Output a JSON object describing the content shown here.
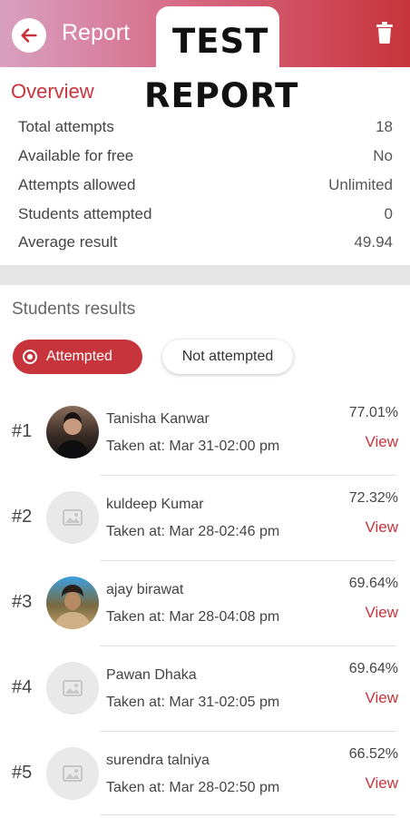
{
  "header": {
    "title": "Report",
    "overlay_line1": "TEST",
    "overlay_line2": "REPORT",
    "accent_color": "#c8343c"
  },
  "overview": {
    "title": "Overview",
    "stats": [
      {
        "label": "Total attempts",
        "value": "18"
      },
      {
        "label": "Available for free",
        "value": "No"
      },
      {
        "label": "Attempts allowed",
        "value": "Unlimited"
      },
      {
        "label": "Students attempted",
        "value": "0"
      },
      {
        "label": "Average result",
        "value": "49.94"
      }
    ]
  },
  "results": {
    "title": "Students results",
    "filters": {
      "attempted": "Attempted",
      "not_attempted": "Not attempted"
    },
    "view_label": "View",
    "students": [
      {
        "rank": "#1",
        "name": "Tanisha Kanwar",
        "taken": "Taken at: Mar 31-02:00 pm",
        "score": "77.01%",
        "avatar": "photo"
      },
      {
        "rank": "#2",
        "name": "kuldeep Kumar",
        "taken": "Taken at: Mar 28-02:46 pm",
        "score": "72.32%",
        "avatar": "placeholder"
      },
      {
        "rank": "#3",
        "name": "ajay birawat",
        "taken": "Taken at: Mar 28-04:08 pm",
        "score": "69.64%",
        "avatar": "photo"
      },
      {
        "rank": "#4",
        "name": "Pawan Dhaka",
        "taken": "Taken at: Mar 31-02:05 pm",
        "score": "69.64%",
        "avatar": "placeholder"
      },
      {
        "rank": "#5",
        "name": "surendra talniya",
        "taken": "Taken at: Mar 28-02:50 pm",
        "score": "66.52%",
        "avatar": "placeholder"
      }
    ]
  },
  "icons": [
    "back-arrow-icon",
    "trash-icon",
    "radio-icon",
    "image-placeholder-icon"
  ]
}
